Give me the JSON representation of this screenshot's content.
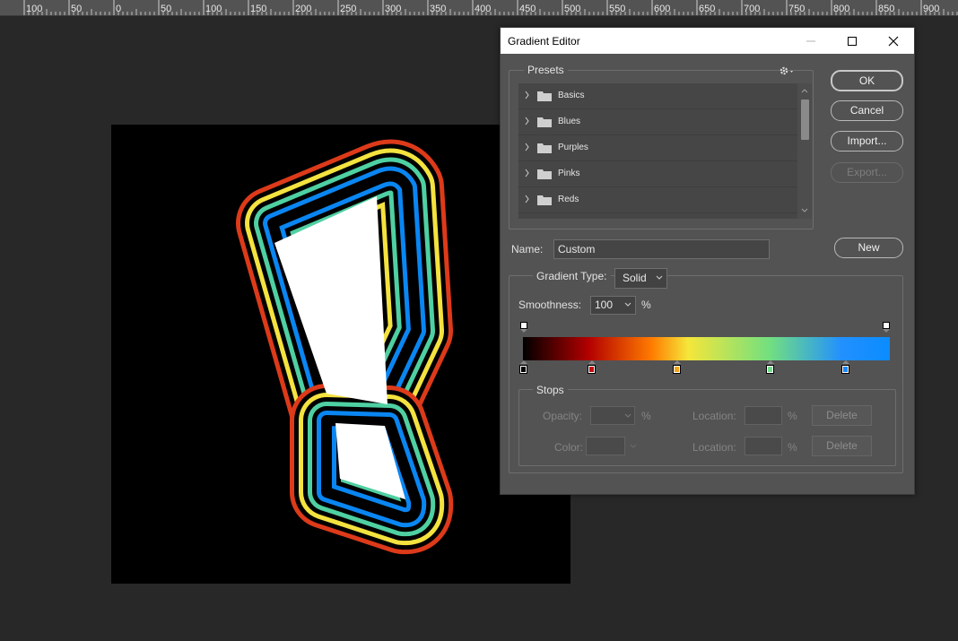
{
  "ruler": {
    "labels": [
      "100",
      "50",
      "0",
      "50",
      "100",
      "150",
      "200",
      "250",
      "300",
      "350",
      "400",
      "450",
      "500",
      "550",
      "600",
      "650",
      "700",
      "750",
      "800",
      "850",
      "900"
    ]
  },
  "artwork": {
    "background": "#000000",
    "ring_colors": [
      "#dd3a1a",
      "#000000",
      "#f4e23f",
      "#000000",
      "#4fd0a2",
      "#000000",
      "#0a86f2",
      "#000000"
    ],
    "fill_color": "#ffffff"
  },
  "dialog": {
    "title": "Gradient Editor",
    "presets_label": "Presets",
    "presets": [
      "Basics",
      "Blues",
      "Purples",
      "Pinks",
      "Reds"
    ],
    "buttons": {
      "ok": "OK",
      "cancel": "Cancel",
      "import": "Import...",
      "export": "Export...",
      "new": "New"
    },
    "name_label": "Name:",
    "name_value": "Custom",
    "gradient_type_label": "Gradient Type:",
    "gradient_type_value": "Solid",
    "smoothness_label": "Smoothness:",
    "smoothness_value": "100",
    "smoothness_unit": "%",
    "gradient_colors": [
      "#000000",
      "#b40000",
      "#ff7b00",
      "#f5e63a",
      "#73e07f",
      "#0a8cff"
    ],
    "color_stops": [
      {
        "color": "#000000",
        "location": 0
      },
      {
        "color": "#c30f0f",
        "location": 0.185
      },
      {
        "color": "#f7a31a",
        "location": 0.417
      },
      {
        "color": "#6fe08a",
        "location": 0.673
      },
      {
        "color": "#1a88ff",
        "location": 0.877
      }
    ],
    "stops": {
      "label": "Stops",
      "opacity_label": "Opacity:",
      "opacity_unit": "%",
      "color_label": "Color:",
      "location_label": "Location:",
      "location_unit": "%",
      "delete_label": "Delete"
    }
  }
}
